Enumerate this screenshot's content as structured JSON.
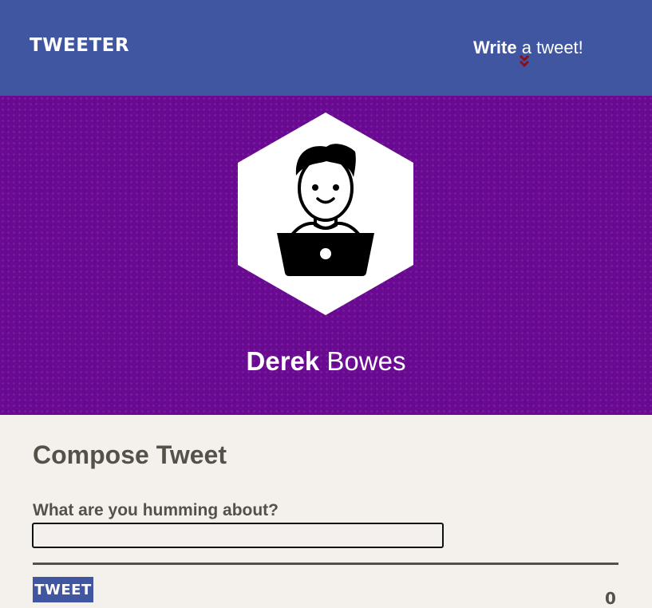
{
  "navbar": {
    "logo": "TWEETER",
    "action_bold": "Write",
    "action_rest": "a tweet!",
    "chevron_icon": "double-chevron-down-icon",
    "chevron_color": "#8b0f1a",
    "background": "#4056a1"
  },
  "profile": {
    "avatar_icon": "person-with-laptop-icon",
    "first_name": "Derek",
    "last_name": "Bowes",
    "background": "#6a0a93"
  },
  "compose": {
    "title": "Compose Tweet",
    "label": "What are you humming about?",
    "input_value": "",
    "button_label": "TWEET",
    "counter": "0"
  },
  "colors": {
    "page_background": "#f4f1ec",
    "text_dark": "#545149"
  }
}
